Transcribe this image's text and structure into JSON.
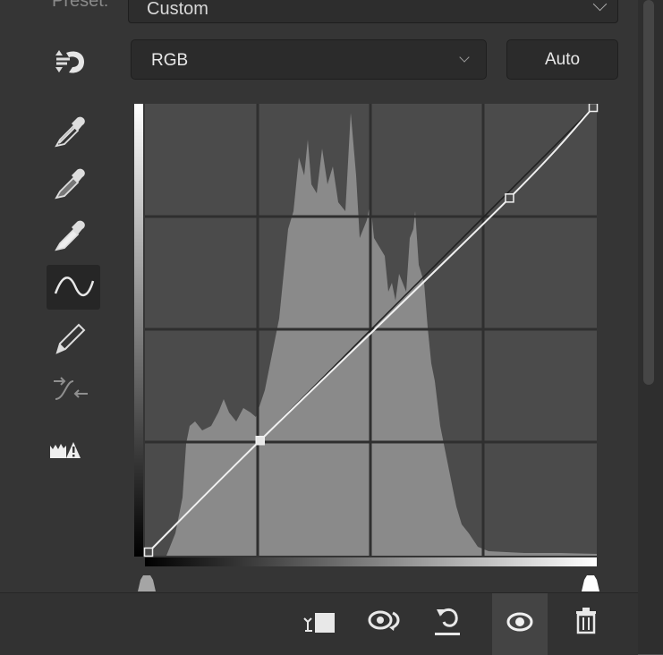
{
  "preset": {
    "label": "Preset:",
    "value": "Custom"
  },
  "channel": {
    "value": "RGB"
  },
  "auto_button": {
    "label": "Auto"
  },
  "tools": [
    "target-adjust-icon",
    "black-eyedropper-icon",
    "gray-eyedropper-icon",
    "white-eyedropper-icon",
    "curve-point-icon",
    "pencil-draw-icon",
    "smooth-curve-icon",
    "clipping-warning-icon"
  ],
  "curve": {
    "input_range": [
      0,
      255
    ],
    "output_range": [
      0,
      255
    ],
    "points": [
      [
        0,
        0
      ],
      [
        64,
        64
      ],
      [
        207,
        203
      ],
      [
        255,
        255
      ]
    ],
    "grid_divisions": 4
  },
  "bottom_icons": [
    "clip-to-layer-icon",
    "view-previous-state-icon",
    "reset-icon",
    "visibility-eye-icon",
    "delete-icon"
  ]
}
